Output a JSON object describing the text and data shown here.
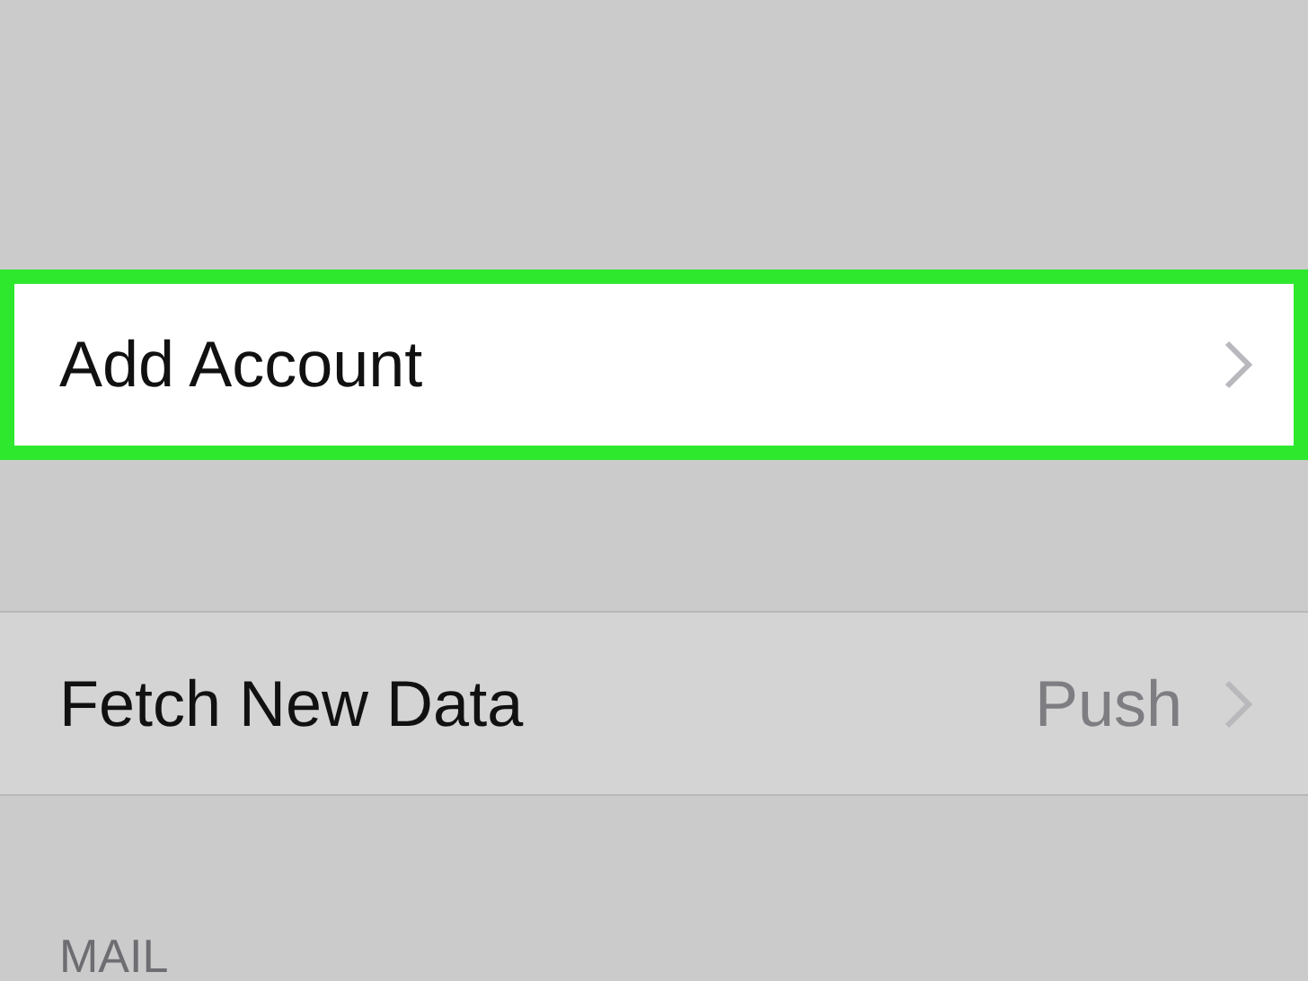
{
  "rows": [
    {
      "label": "Add Account",
      "highlighted": true
    },
    {
      "label": "Fetch New Data",
      "value": "Push",
      "highlighted": false
    }
  ],
  "section_header": "MAIL"
}
